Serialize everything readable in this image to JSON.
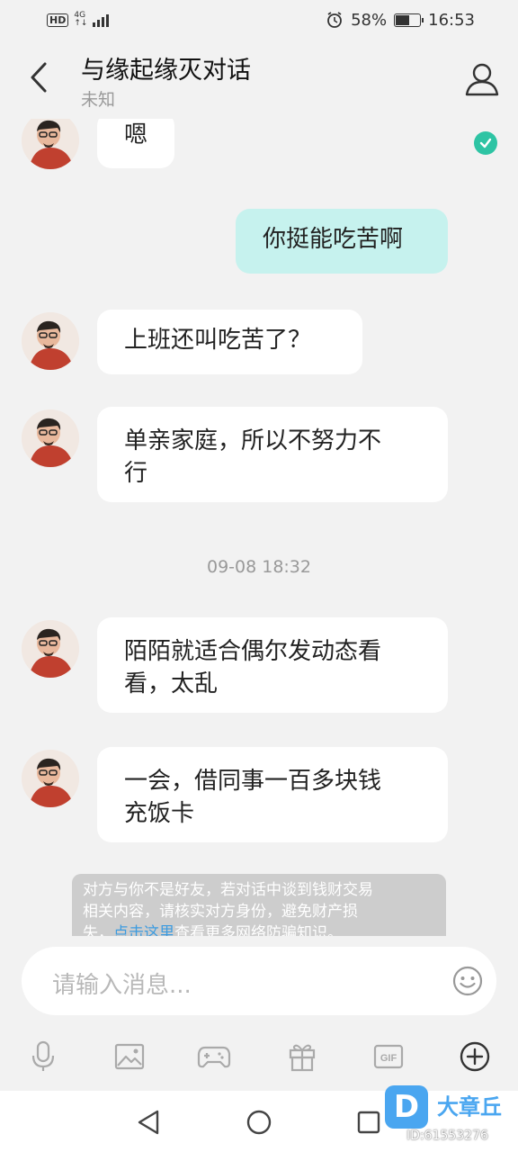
{
  "status_bar": {
    "hd": "HD",
    "network_top": "4G",
    "network_bottom": "↑↓",
    "battery": "58%",
    "battery_level": 0.58,
    "time": "16:53"
  },
  "header": {
    "title": "与缘起缘灭对话",
    "subtitle": "未知"
  },
  "messages": [
    {
      "from": "them",
      "text": "嗯"
    },
    {
      "from": "me",
      "text": "你挺能吃苦啊",
      "read": true
    },
    {
      "from": "them",
      "text": "上班还叫吃苦了？"
    },
    {
      "from": "them",
      "text_line1": "单亲家庭，所以不努力不",
      "text_line2": "行"
    },
    {
      "from": "them",
      "text_line1": "陌陌就适合偶尔发动态看",
      "text_line2": "看，太乱"
    },
    {
      "from": "them",
      "text_line1": "一会，借同事一百多块钱",
      "text_line2": "充饭卡"
    }
  ],
  "timestamp": "09-08 18:32",
  "notice": {
    "line1": "对方与你不是好友，若对话中谈到钱财交易",
    "line2": "相关内容，请核实对方身份，避免财产损",
    "line3_prefix": "失，",
    "link": "点击这里",
    "line3_suffix": "查看更多网络防骗知识。"
  },
  "input": {
    "placeholder": "请输入消息..."
  },
  "toolbar": {
    "icons": [
      "microphone-icon",
      "image-icon",
      "gamepad-icon",
      "gift-icon",
      "gif-icon",
      "plus-circle-icon"
    ],
    "gif_label": "GIF"
  },
  "watermark": {
    "logo_letter": "D",
    "name": "大章丘",
    "id": "ID:61553276"
  },
  "colors": {
    "my_bubble": "#c6f2ee",
    "their_bubble": "#ffffff",
    "read_check": "#2ec4a4",
    "background": "#f2f2f2",
    "link": "#3b9be0"
  }
}
